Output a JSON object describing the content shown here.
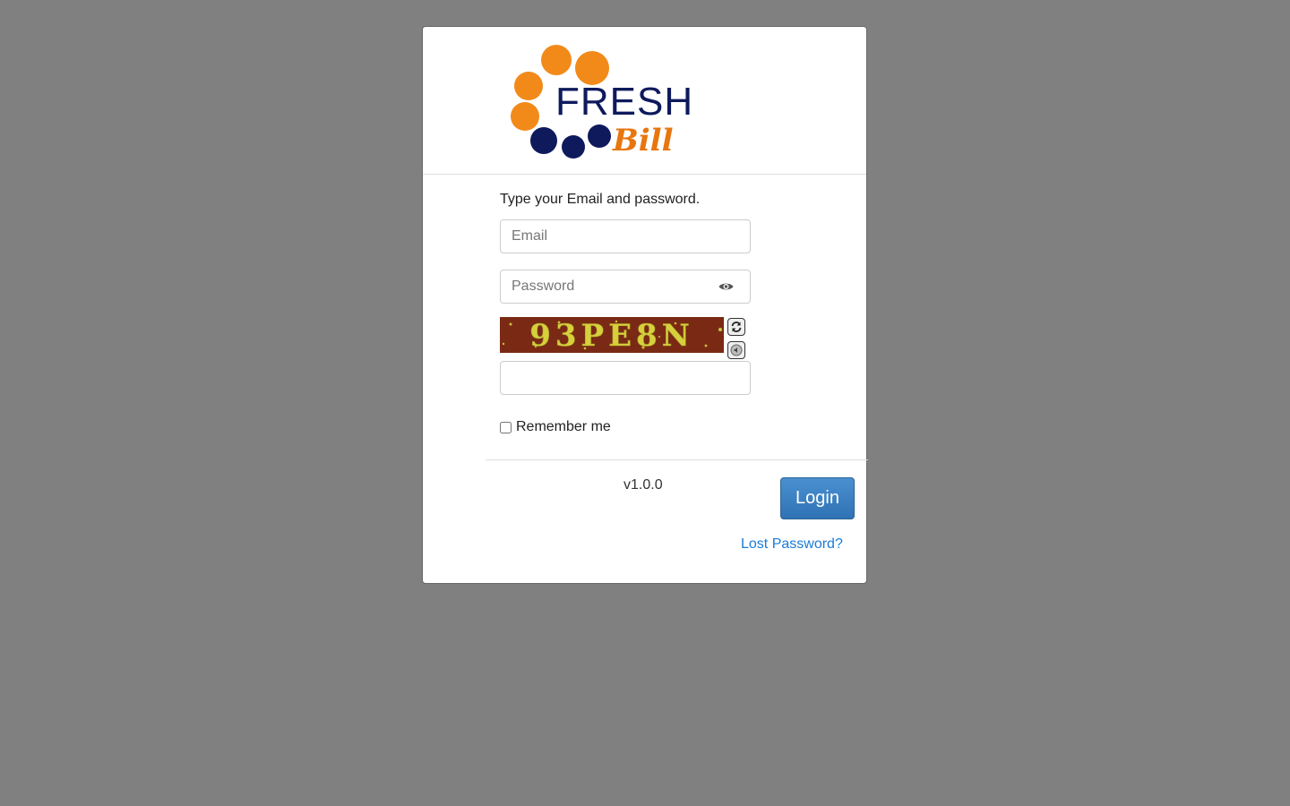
{
  "logo": {
    "word1": "FRESH",
    "word2": "Bill",
    "colors": {
      "orange": "#f28a1a",
      "navy": "#0e1a5c",
      "bill": "#e8760f"
    }
  },
  "form": {
    "instructions": "Type your Email and password.",
    "email_placeholder": "Email",
    "password_placeholder": "Password",
    "captcha_text": "93PE8N",
    "captcha_input_value": "",
    "remember_label": "Remember me",
    "remember_checked": false
  },
  "footer": {
    "version": "v1.0.0",
    "login_label": "Login",
    "lost_password_label": "Lost Password?"
  },
  "icons": {
    "password_toggle": "eye-icon",
    "captcha_refresh": "refresh-icon",
    "captcha_audio": "audio-icon"
  },
  "colors": {
    "page_background": "#808080",
    "primary": "#337ab7",
    "link": "#1a7bd8"
  }
}
